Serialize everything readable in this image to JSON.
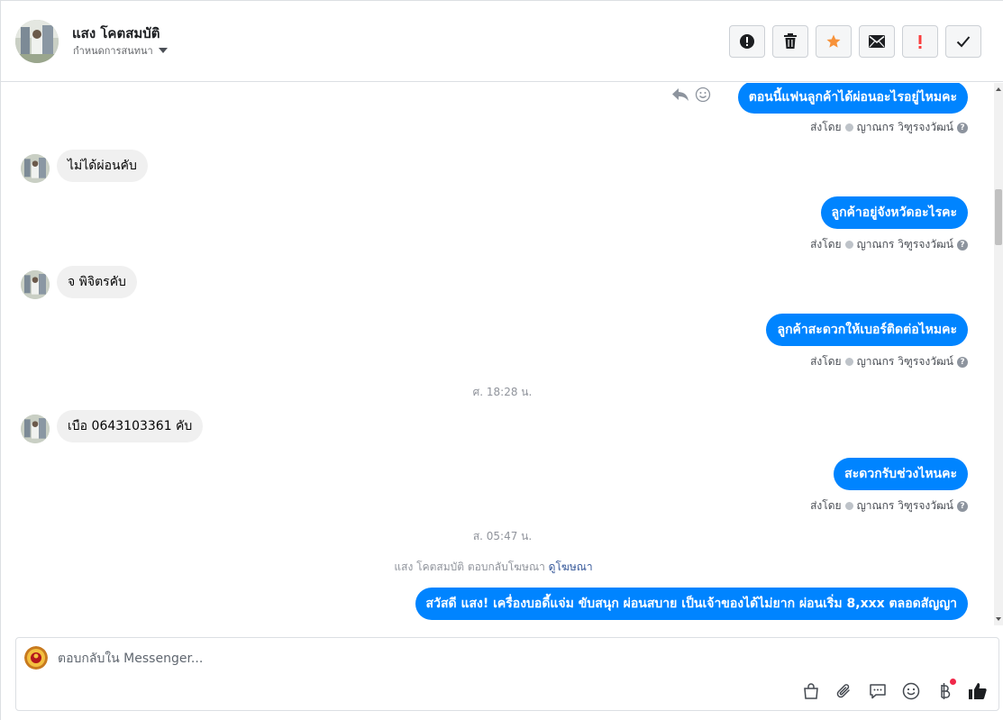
{
  "header": {
    "contact_name": "แสง โคตสมบัติ",
    "assign_label": "กำหนดการสนทนา",
    "actions": [
      "spam",
      "delete",
      "star",
      "mark-unread",
      "important",
      "done"
    ]
  },
  "colors": {
    "accent": "#0084ff",
    "incoming_bubble": "#f0f0f0",
    "star": "#f7923a",
    "important": "#fa3e3e"
  },
  "messages": {
    "out1": "ตอนนี้แฟนลูกค้าได้ผ่อนอะไรอยู่ไหมคะ",
    "in1": "ไม่ได้ผ่อนคับ",
    "out2": "ลูกค้าอยู่จังหวัดอะไรคะ",
    "in2": "จ  พิจิตรคับ",
    "out3": "ลูกค้าสะดวกให้เบอร์ติดต่อไหมคะ",
    "time1": "ศ. 18:28 น.",
    "in3": "เบือ  0643103361 คับ",
    "out4": "สะดวกรับช่วงไหนคะ",
    "time2": "ส. 05:47 น.",
    "ad_reply_text": "แสง โคตสมบัติ ตอบกลับโฆษณา",
    "ad_reply_link": "ดูโฆษณา",
    "out5": "สวัสดี แสง! เครื่องบอดี้แจ่ม ขับสนุก ผ่อนสบาย  เป็นเจ้าของได้ไม่ยาก ผ่อนเริ่ม 8,xxx ตลอดสัญญา"
  },
  "sent_by": {
    "prefix": "ส่งโดย",
    "agent": "ญาณกร วิฑูรจงวัฒน์"
  },
  "composer": {
    "placeholder": "ตอบกลับใน Messenger..."
  }
}
